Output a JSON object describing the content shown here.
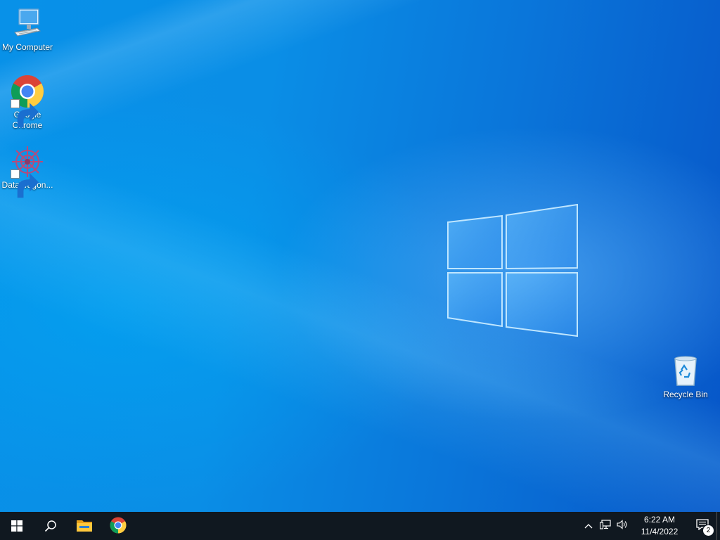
{
  "desktop": {
    "icons": [
      {
        "label": "My Computer",
        "icon": "computer-icon"
      },
      {
        "label": "Google\nChrome",
        "line1": "Google",
        "line2": "Chrome",
        "icon": "chrome-icon",
        "shortcut": true
      },
      {
        "label": "DataWagon...",
        "icon": "datawagon-icon",
        "shortcut": true
      },
      {
        "label": "Recycle Bin",
        "icon": "recycle-bin-icon"
      }
    ]
  },
  "taskbar": {
    "start": {
      "icon": "windows-start-icon"
    },
    "search": {
      "icon": "search-icon"
    },
    "pinned": [
      {
        "name": "File Explorer",
        "icon": "file-explorer-icon"
      },
      {
        "name": "Google Chrome",
        "icon": "chrome-icon"
      }
    ],
    "tray": {
      "icons": [
        "chevron-up-icon",
        "network-icon",
        "volume-icon"
      ],
      "time": "6:22 AM",
      "date": "11/4/2022",
      "notification_count": "2"
    }
  },
  "colors": {
    "taskbar_bg": "#101820",
    "accent": "#0a8ee6"
  }
}
